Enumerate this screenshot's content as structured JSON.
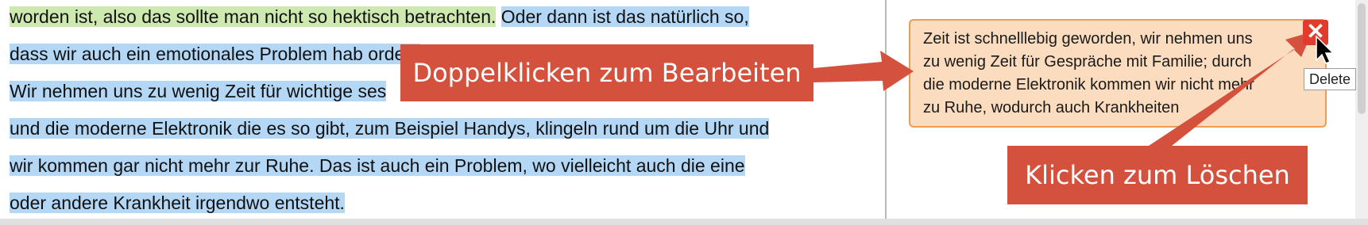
{
  "editor": {
    "lines": [
      {
        "segments": [
          {
            "text": "worden ist, also das sollte man nicht so hektisch betrachten.",
            "hl": "green"
          },
          {
            "text": " ",
            "hl": "none"
          },
          {
            "text": "Oder dann ist das natürlich so,",
            "hl": "blue"
          }
        ]
      },
      {
        "segments": [
          {
            "text": "dass wir auch ein emotionales Problem hab",
            "hl": "blue"
          },
          {
            "text": "",
            "hl": "none"
          },
          {
            "text": "                                                    orden.",
            "hl": "blue"
          }
        ]
      },
      {
        "segments": [
          {
            "text": "Wir nehmen uns zu wenig Zeit für wichtige",
            "hl": "blue"
          },
          {
            "text": "",
            "hl": "none"
          },
          {
            "text": "                                                     ses",
            "hl": "blue"
          }
        ]
      },
      {
        "segments": [
          {
            "text": "und die moderne Elektronik die es so gibt, zum Beispiel Handys, klingeln rund um die Uhr und",
            "hl": "blue"
          }
        ]
      },
      {
        "segments": [
          {
            "text": "wir kommen gar nicht mehr zur Ruhe. Das ist auch ein Problem, wo vielleicht auch die eine",
            "hl": "blue"
          }
        ]
      },
      {
        "segments": [
          {
            "text": "oder andere Krankheit irgendwo entsteht.",
            "hl": "blue"
          }
        ]
      }
    ]
  },
  "comment": {
    "lines": [
      "Zeit ist schnelllebig geworden, wir nehmen uns",
      "zu wenig Zeit für Gespräche mit Familie; durch",
      "die moderne Elektronik kommen wir nicht mehr",
      "zu Ruhe, wodurch auch Krankheiten"
    ],
    "delete_glyph": "✕",
    "delete_tooltip": "Delete"
  },
  "callouts": {
    "edit": "Doppelklicken zum Bearbeiten",
    "delete": "Klicken zum Löschen"
  },
  "colors": {
    "highlight_green": "#cde9b0",
    "highlight_blue": "#b3d7f5",
    "comment_bg": "#fcdcbf",
    "comment_border": "#f09a52",
    "callout_bg": "#d3513d",
    "delete_button": "#e23a2d"
  }
}
